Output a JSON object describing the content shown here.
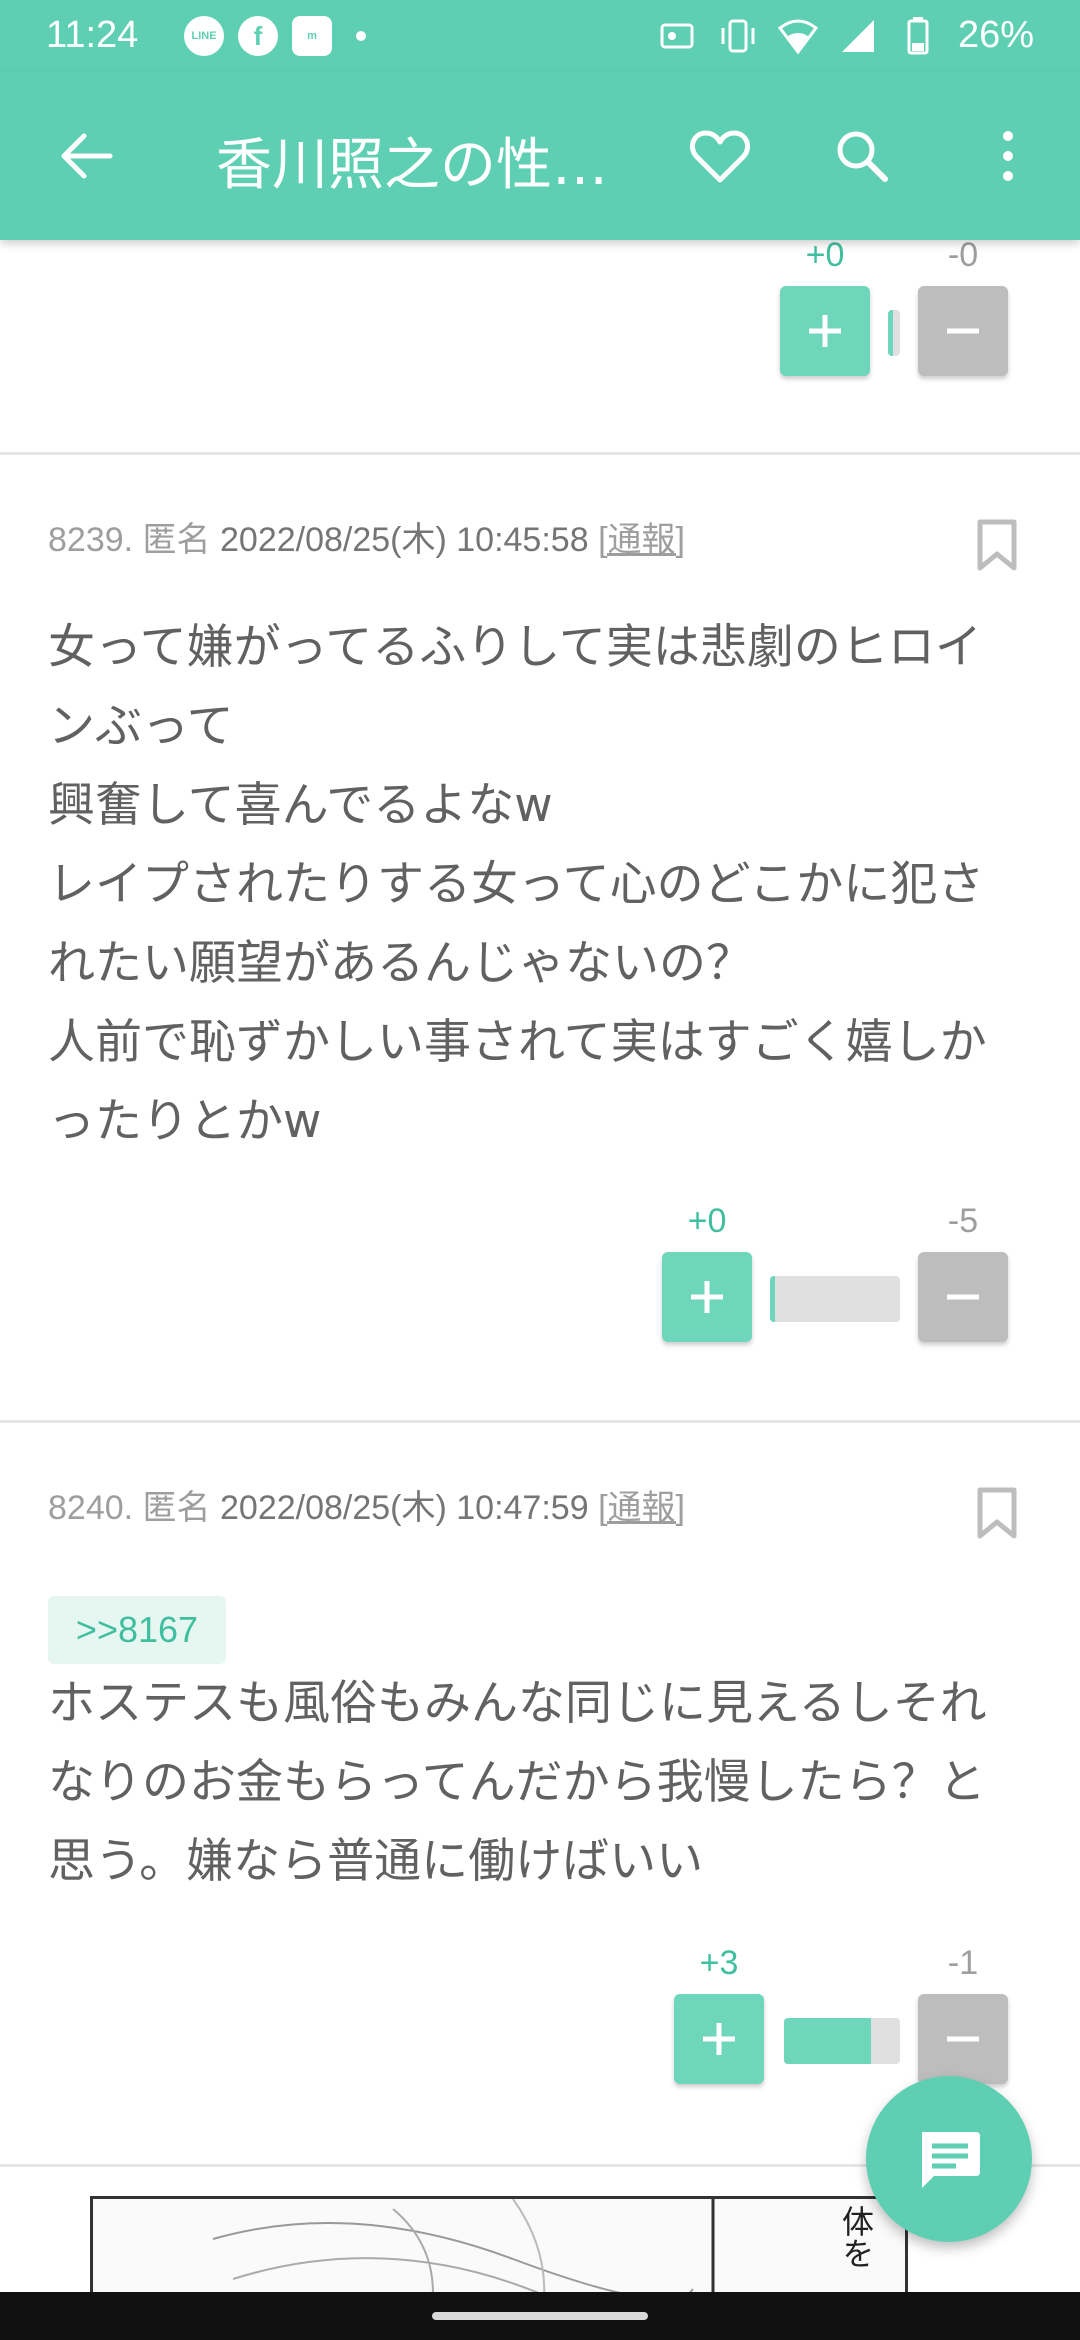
{
  "status_bar": {
    "time": "11:24",
    "battery": "26%",
    "left_icons": [
      "line-icon",
      "facebook-icon",
      "notification-app-icon",
      "dot-icon"
    ],
    "right_icons": [
      "nfc-icon",
      "vibrate-icon",
      "wifi-icon",
      "signal-icon",
      "battery-icon"
    ]
  },
  "toolbar": {
    "title": "香川照之の性…",
    "accent": "#5ecfb2"
  },
  "comments": [
    {
      "votes": {
        "plus": "+0",
        "minus": "-0",
        "positive_fraction": 0
      }
    },
    {
      "number": "8239.",
      "author": "匿名",
      "date": "2022/08/25(木) 10:45:58",
      "report": "[通報]",
      "lines": [
        "女って嫌がってるふりして実は悲劇のヒロイ",
        "ンぶって",
        "興奮して喜んでるよなw",
        "レイプされたりする女って心のどこかに犯さ",
        "れたい願望があるんじゃないの？",
        "人前で恥ずかしい事されて実はすごく嬉しか",
        "ったりとかw"
      ],
      "votes": {
        "plus": "+0",
        "minus": "-5",
        "positive_fraction": 0
      }
    },
    {
      "number": "8240.",
      "author": "匿名",
      "date": "2022/08/25(木) 10:47:59",
      "report": "[通報]",
      "anchor": ">>8167",
      "lines": [
        "ホステスも風俗もみんな同じに見えるしそれ",
        "なりのお金もらってんだから我慢したら？と",
        "思う。嫌なら普通に働けばいい"
      ],
      "votes": {
        "plus": "+3",
        "minus": "-1",
        "positive_fraction": 0.75
      }
    }
  ],
  "image_text": "体を"
}
